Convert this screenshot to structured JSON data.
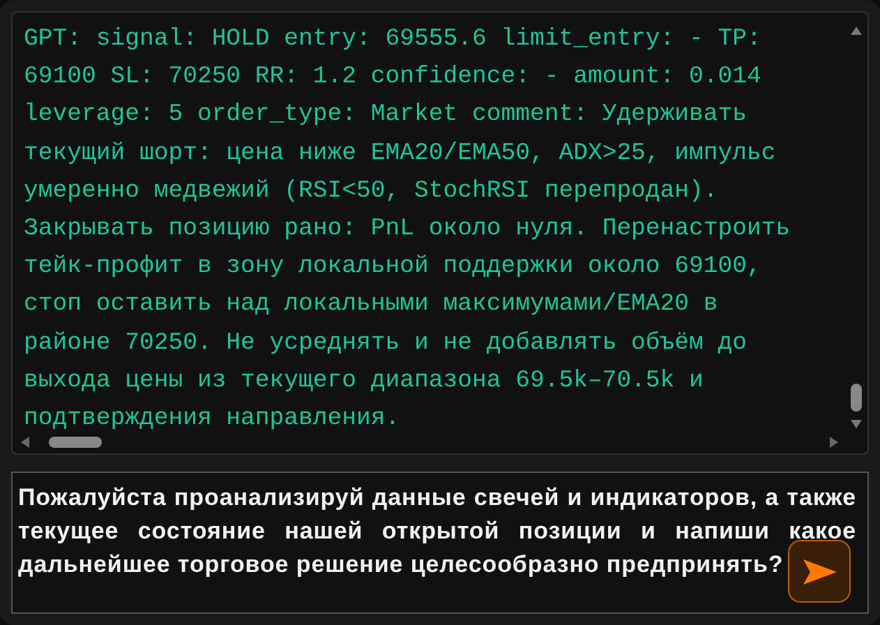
{
  "chat_log": {
    "message": "GPT: signal: HOLD entry: 69555.6 limit_entry: - TP: 69100 SL: 70250 RR: 1.2 confidence: - amount: 0.014 leverage: 5 order_type: Market comment: Удерживать текущий шорт: цена ниже EMA20/EMA50, ADX>25, импульс умеренно медвежий (RSI<50, StochRSI перепродан). Закрывать позицию рано: PnL около нуля. Перенастроить тейк-профит в зону локальной поддержки около 69100, стоп оставить над локальными максимумами/EMA20 в районе 70250. Не усреднять и не добавлять объём до выхода цены из текущего диапазона 69.5k–70.5k и подтверждения направления."
  },
  "prompt": {
    "value": "Пожалуйста проанализируй данные свечей и индикаторов, а также текущее состояние нашей открытой позиции и напиши какое дальнейшее торговое решение целесообразно предпринять?"
  }
}
